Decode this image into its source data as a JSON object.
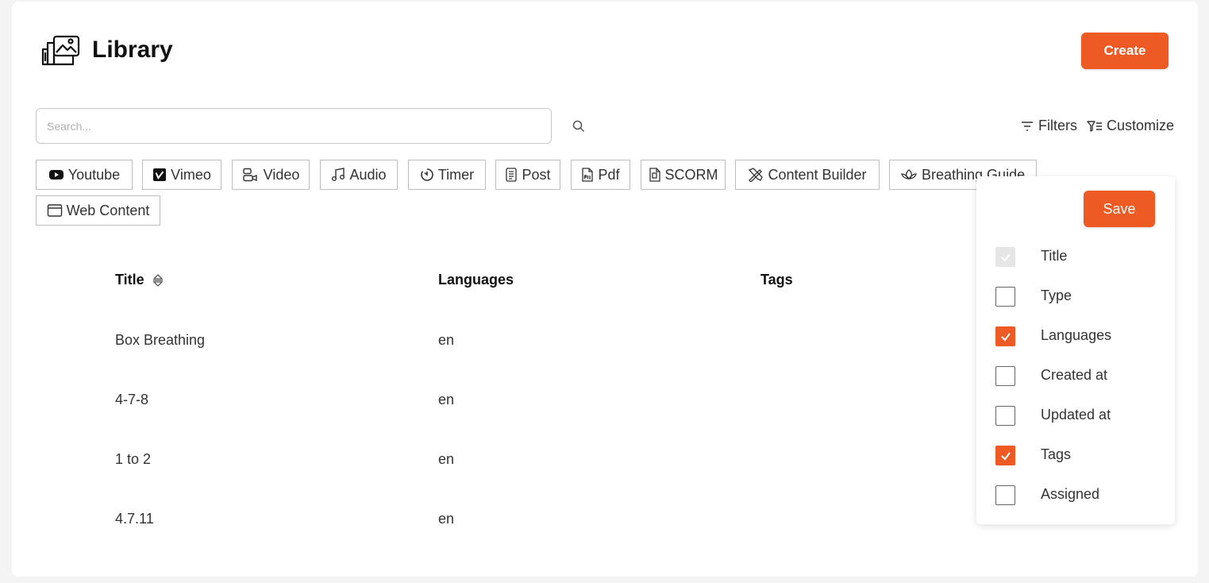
{
  "header": {
    "title": "Library",
    "create_label": "Create"
  },
  "search": {
    "placeholder": "Search..."
  },
  "toolbar": {
    "filters_label": "Filters",
    "customize_label": "Customize"
  },
  "types": [
    {
      "label": "Youtube",
      "icon": "youtube-icon"
    },
    {
      "label": "Vimeo",
      "icon": "vimeo-icon"
    },
    {
      "label": "Video",
      "icon": "video-icon"
    },
    {
      "label": "Audio",
      "icon": "audio-icon"
    },
    {
      "label": "Timer",
      "icon": "timer-icon"
    },
    {
      "label": "Post",
      "icon": "post-icon"
    },
    {
      "label": "Pdf",
      "icon": "pdf-icon"
    },
    {
      "label": "SCORM",
      "icon": "scorm-icon"
    },
    {
      "label": "Content Builder",
      "icon": "content-builder-icon"
    },
    {
      "label": "Breathing Guide",
      "icon": "breathing-guide-icon"
    },
    {
      "label": "Web Content",
      "icon": "web-content-icon"
    }
  ],
  "table": {
    "columns": [
      "Title",
      "Languages",
      "Tags"
    ],
    "rows": [
      {
        "title": "Box Breathing",
        "languages": "en",
        "tags": ""
      },
      {
        "title": "4-7-8",
        "languages": "en",
        "tags": ""
      },
      {
        "title": "1 to 2",
        "languages": "en",
        "tags": ""
      },
      {
        "title": "4.7.11",
        "languages": "en",
        "tags": ""
      }
    ]
  },
  "customize_menu": {
    "save_label": "Save",
    "options": [
      {
        "label": "Title",
        "checked": true,
        "disabled": true
      },
      {
        "label": "Type",
        "checked": false,
        "disabled": false
      },
      {
        "label": "Languages",
        "checked": true,
        "disabled": false
      },
      {
        "label": "Created at",
        "checked": false,
        "disabled": false
      },
      {
        "label": "Updated at",
        "checked": false,
        "disabled": false
      },
      {
        "label": "Tags",
        "checked": true,
        "disabled": false
      },
      {
        "label": "Assigned",
        "checked": false,
        "disabled": false
      }
    ]
  },
  "colors": {
    "accent": "#ee5a24",
    "text": "#222222",
    "border": "#bdbdbd",
    "background": "#f4f4f4"
  }
}
